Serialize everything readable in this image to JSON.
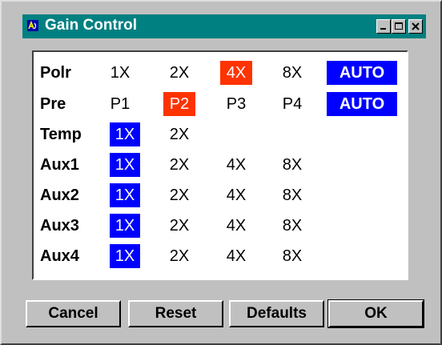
{
  "window": {
    "title": "Gain Control",
    "title_bar_color": "#008080"
  },
  "colors": {
    "selected_auto": "#0000ff",
    "selected_manual": "#ff3300"
  },
  "rows": [
    {
      "label": "Polr",
      "options": [
        "1X",
        "2X",
        "4X",
        "8X",
        "AUTO"
      ],
      "selected": "4X",
      "auto_selected": true
    },
    {
      "label": "Pre",
      "options": [
        "P1",
        "P2",
        "P3",
        "P4",
        "AUTO"
      ],
      "selected": "P2",
      "auto_selected": true
    },
    {
      "label": "Temp",
      "options": [
        "1X",
        "2X"
      ],
      "selected": "1X"
    },
    {
      "label": "Aux1",
      "options": [
        "1X",
        "2X",
        "4X",
        "8X"
      ],
      "selected": "1X"
    },
    {
      "label": "Aux2",
      "options": [
        "1X",
        "2X",
        "4X",
        "8X"
      ],
      "selected": "1X"
    },
    {
      "label": "Aux3",
      "options": [
        "1X",
        "2X",
        "4X",
        "8X"
      ],
      "selected": "1X"
    },
    {
      "label": "Aux4",
      "options": [
        "1X",
        "2X",
        "4X",
        "8X"
      ],
      "selected": "1X"
    }
  ],
  "buttons": {
    "cancel": "Cancel",
    "reset": "Reset",
    "defaults": "Defaults",
    "ok": "OK"
  },
  "icons": {
    "title": "app-icon",
    "minimize": "minimize-icon",
    "maximize": "maximize-icon",
    "close": "close-icon"
  }
}
